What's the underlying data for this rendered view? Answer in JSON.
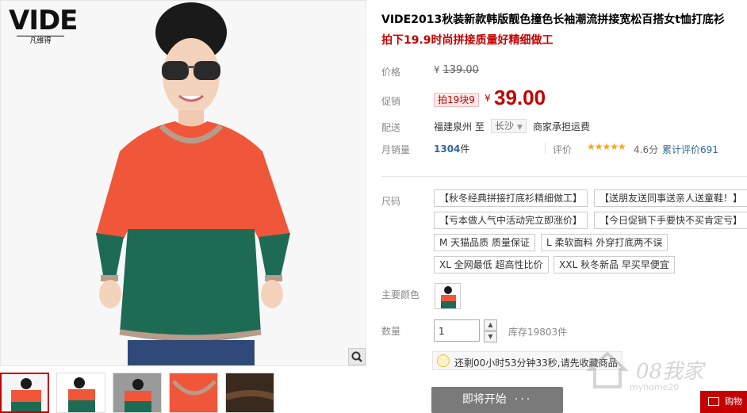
{
  "brand": {
    "logo_text": "VIDE",
    "logo_sub": "凡维得"
  },
  "product": {
    "title": "VIDE2013秋装新款韩版靓色撞色长袖潮流拼接宽松百搭女t恤打底衫",
    "subtitle": "拍下19.9时尚拼接质量好精细做工"
  },
  "price": {
    "label": "价格",
    "currency": "¥",
    "original": "139.00",
    "promo_label": "促销",
    "promo_badge": "拍19块9",
    "promo_price": "39.00"
  },
  "shipping": {
    "label": "配送",
    "from": "福建泉州 至",
    "to": "长沙",
    "fee": "商家承担运费"
  },
  "sales": {
    "label": "月销量",
    "count": "1304",
    "unit": "件",
    "rating_label": "评价",
    "stars": "★★★★★",
    "rating_value": 4.6,
    "rating_text": "4.6分",
    "review_link": "累计评价691"
  },
  "sizes": {
    "label": "尺码",
    "options": [
      "【秋冬经典拼接打底衫精细做工】",
      "【送朋友送同事送亲人送童鞋！】",
      "【亏本做人气中活动完立即涨价】",
      "【今日促销下手要快不买肯定亏】",
      "M 天猫品质 质量保证",
      "L 柔软面料 外穿打底两不误",
      "XL 全网最低 超高性比价",
      "XXL 秋冬新品 早买早便宜"
    ]
  },
  "color": {
    "label": "主要颜色"
  },
  "quantity": {
    "label": "数量",
    "value": "1",
    "stock": "库存19803件"
  },
  "countdown": {
    "text": "还剩00小时53分钟33秒,请先收藏商品"
  },
  "buy": {
    "label": "即将开始",
    "dots": "···"
  },
  "watermark": {
    "text": "08我家",
    "sub": "myhome20"
  },
  "cart": {
    "label": "购物"
  },
  "colors": {
    "accent": "#c40000",
    "link": "#336699",
    "shirt_orange": "#f0573a",
    "shirt_green": "#1e6b55"
  }
}
